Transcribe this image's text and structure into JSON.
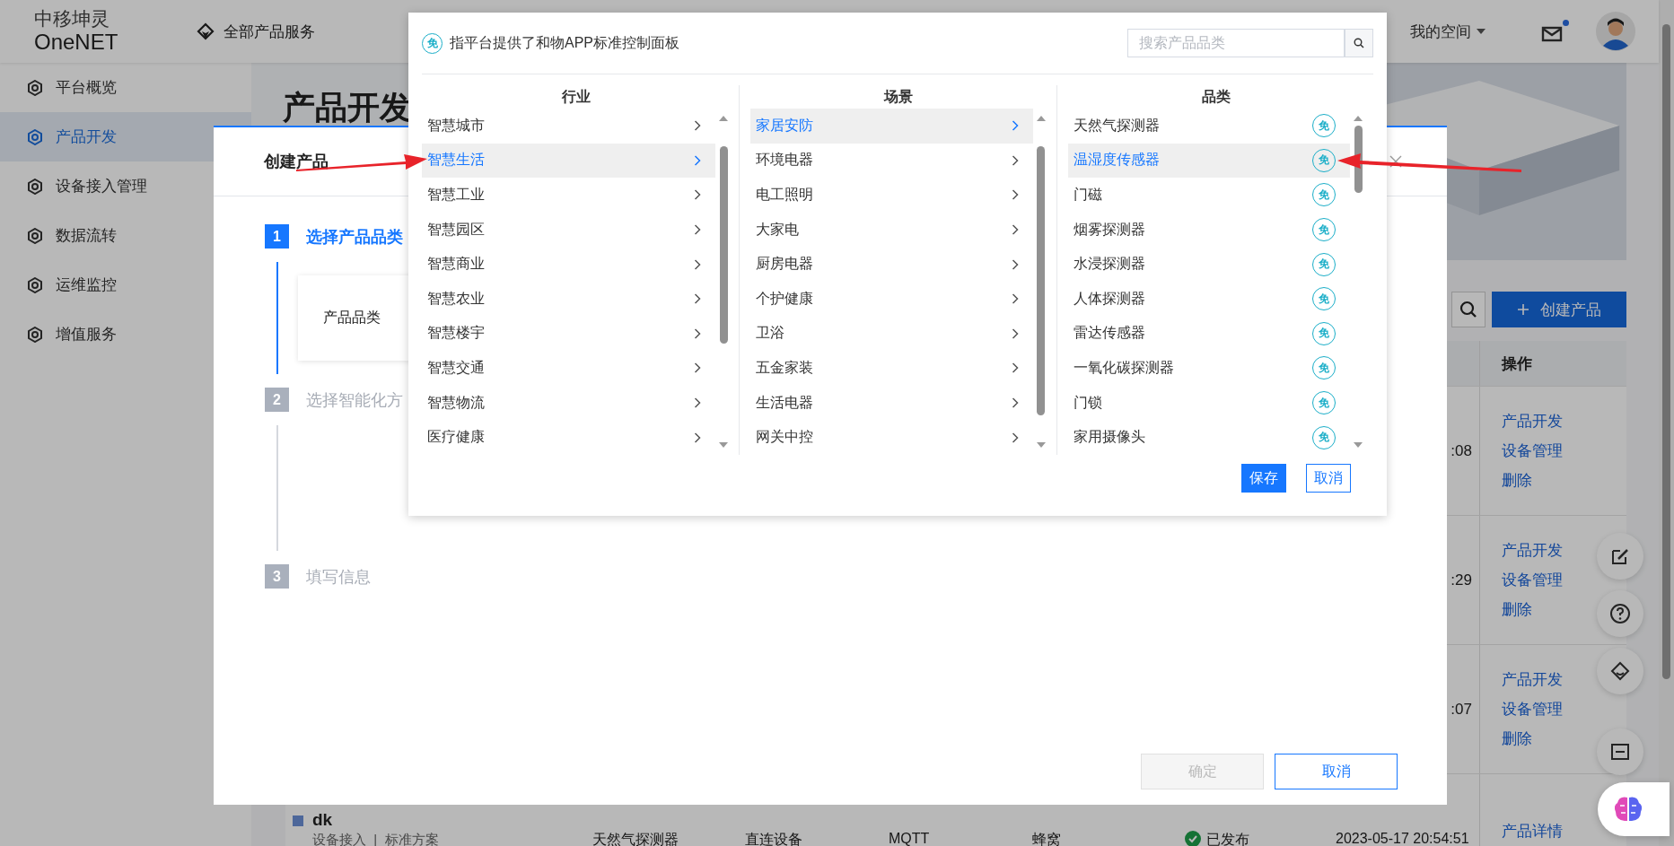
{
  "header": {
    "logo_cn": "中移坤灵",
    "logo_en": "OneNET",
    "all_services": "全部产品服务",
    "workspace": "我的空间",
    "unread": true
  },
  "sidebar": {
    "items": [
      {
        "label": "平台概览",
        "selected": false
      },
      {
        "label": "产品开发",
        "selected": true
      },
      {
        "label": "设备接入管理",
        "selected": false
      },
      {
        "label": "数据流转",
        "selected": false
      },
      {
        "label": "运维监控",
        "selected": false
      },
      {
        "label": "增值服务",
        "selected": false
      }
    ]
  },
  "page": {
    "title": "产品开发",
    "create_button": "创建产品",
    "table": {
      "action_column": "操作",
      "rows": [
        {
          "time": ":08",
          "actions": [
            "产品开发",
            "设备管理",
            "删除"
          ]
        },
        {
          "time": ":29",
          "actions": [
            "产品开发",
            "设备管理",
            "删除"
          ]
        },
        {
          "time": ":07",
          "actions": [
            "产品开发",
            "设备管理",
            "删除"
          ]
        },
        {
          "name": "dk",
          "meta": "设备接入  |  标准方案",
          "category": "天然气探测器",
          "node_type": "直连设备",
          "protocol": "MQTT",
          "network": "蜂窝",
          "status": "已发布",
          "time": "2023-05-17 20:54:51",
          "actions": [
            "产品详情"
          ]
        }
      ]
    }
  },
  "modal": {
    "title": "创建产品",
    "steps": [
      {
        "number": "1",
        "label": "选择产品品类",
        "active": true
      },
      {
        "number": "2",
        "label": "选择智能化方",
        "active": false
      },
      {
        "number": "3",
        "label": "填写信息",
        "active": false
      }
    ],
    "field_label": "产品品类",
    "buttons": [
      {
        "label": "确定",
        "disabled": true,
        "kind": "primary"
      },
      {
        "label": "取消",
        "disabled": false,
        "kind": "outline"
      }
    ]
  },
  "picker": {
    "badge": "免",
    "note": "指平台提供了和物APP标准控制面板",
    "search_placeholder": "搜索产品品类",
    "columns": [
      {
        "heading": "行业",
        "kind": "nav",
        "items": [
          {
            "label": "智慧城市",
            "selected": false
          },
          {
            "label": "智慧生活",
            "selected": true
          },
          {
            "label": "智慧工业",
            "selected": false
          },
          {
            "label": "智慧园区",
            "selected": false
          },
          {
            "label": "智慧商业",
            "selected": false
          },
          {
            "label": "智慧农业",
            "selected": false
          },
          {
            "label": "智慧楼宇",
            "selected": false
          },
          {
            "label": "智慧交通",
            "selected": false
          },
          {
            "label": "智慧物流",
            "selected": false
          },
          {
            "label": "医疗健康",
            "selected": false
          }
        ]
      },
      {
        "heading": "场景",
        "kind": "nav",
        "items": [
          {
            "label": "家居安防",
            "selected": true
          },
          {
            "label": "环境电器",
            "selected": false
          },
          {
            "label": "电工照明",
            "selected": false
          },
          {
            "label": "大家电",
            "selected": false
          },
          {
            "label": "厨房电器",
            "selected": false
          },
          {
            "label": "个护健康",
            "selected": false
          },
          {
            "label": "卫浴",
            "selected": false
          },
          {
            "label": "五金家装",
            "selected": false
          },
          {
            "label": "生活电器",
            "selected": false
          },
          {
            "label": "网关中控",
            "selected": false
          }
        ]
      },
      {
        "heading": "品类",
        "kind": "leaf",
        "items": [
          {
            "label": "天然气探测器",
            "selected": false,
            "badge": "免"
          },
          {
            "label": "温湿度传感器",
            "selected": true,
            "badge": "免"
          },
          {
            "label": "门磁",
            "selected": false,
            "badge": "免"
          },
          {
            "label": "烟雾探测器",
            "selected": false,
            "badge": "免"
          },
          {
            "label": "水浸探测器",
            "selected": false,
            "badge": "免"
          },
          {
            "label": "人体探测器",
            "selected": false,
            "badge": "免"
          },
          {
            "label": "雷达传感器",
            "selected": false,
            "badge": "免"
          },
          {
            "label": "一氧化碳探测器",
            "selected": false,
            "badge": "免"
          },
          {
            "label": "门锁",
            "selected": false,
            "badge": "免"
          },
          {
            "label": "家用摄像头",
            "selected": false,
            "badge": "免"
          }
        ]
      }
    ],
    "buttons": [
      {
        "label": "保存",
        "kind": "primary"
      },
      {
        "label": "取消",
        "kind": "outline"
      }
    ]
  }
}
